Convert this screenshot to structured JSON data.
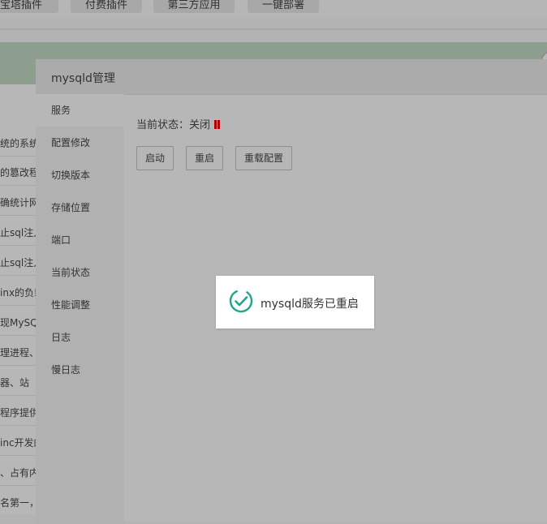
{
  "background": {
    "tabs": [
      "宝塔插件",
      "付费插件",
      "第三方应用",
      "一键部署"
    ],
    "list_items": [
      "统的系统",
      "的篡改程",
      "确统计网",
      "止sql注入",
      "止sql注入",
      "inx的负载",
      "现MySQL",
      "理进程、",
      "器、站",
      "程序提供",
      "inc开发的",
      "、占有内",
      "名第一，"
    ]
  },
  "modal": {
    "title": "mysqld管理",
    "sidebar": [
      "服务",
      "配置修改",
      "切换版本",
      "存储位置",
      "端口",
      "当前状态",
      "性能调整",
      "日志",
      "慢日志"
    ],
    "status_label": "当前状态：关闭",
    "buttons": {
      "start": "启动",
      "restart": "重启",
      "reload": "重载配置"
    }
  },
  "toast": {
    "message": "mysqld服务已重启",
    "icon": "check-circle-icon"
  },
  "colors": {
    "status_off": "#b30000",
    "toast_check": "#20a58a"
  }
}
